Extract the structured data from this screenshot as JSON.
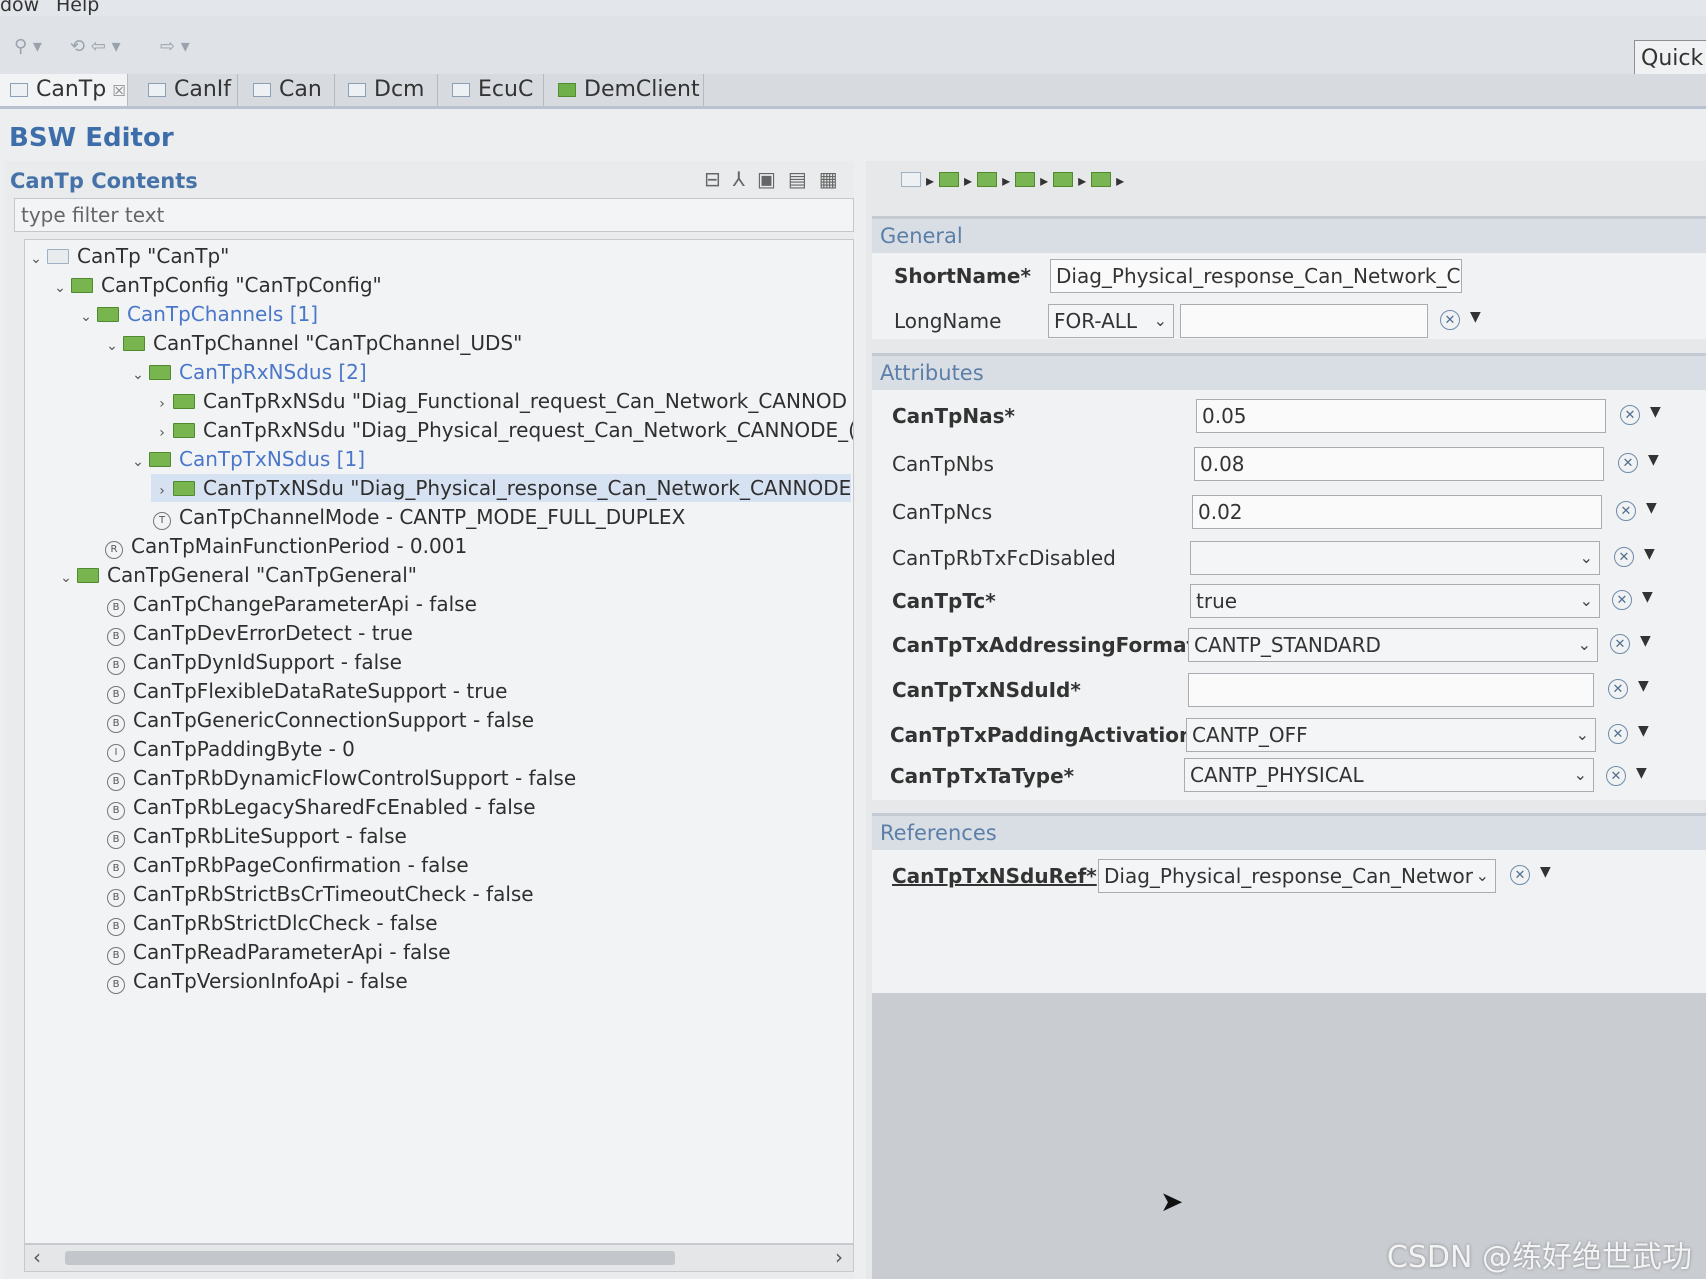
{
  "menu": {
    "window": "dow",
    "help": "Help"
  },
  "toolbar": {
    "quick_access": "Quick"
  },
  "tabs": [
    {
      "label": "CanTp",
      "close": "☒"
    },
    {
      "label": "CanIf"
    },
    {
      "label": "Can"
    },
    {
      "label": "Dcm"
    },
    {
      "label": "EcuC"
    },
    {
      "label": "DemClient"
    }
  ],
  "editor": {
    "title": "BSW Editor"
  },
  "left": {
    "title": "CanTp Contents",
    "filter_placeholder": "type filter text",
    "tree": [
      "CanTp \"CanTp\"",
      "CanTpConfig \"CanTpConfig\"",
      "CanTpChannels [1]",
      "CanTpChannel \"CanTpChannel_UDS\"",
      "CanTpRxNSdus [2]",
      "CanTpRxNSdu \"Diag_Functional_request_Can_Network_CANNOD",
      "CanTpRxNSdu \"Diag_Physical_request_Can_Network_CANNODE_(",
      "CanTpTxNSdus [1]",
      "CanTpTxNSdu \"Diag_Physical_response_Can_Network_CANNODE",
      "CanTpChannelMode - CANTP_MODE_FULL_DUPLEX",
      "CanTpMainFunctionPeriod - 0.001",
      "CanTpGeneral \"CanTpGeneral\"",
      "CanTpChangeParameterApi - false",
      "CanTpDevErrorDetect - true",
      "CanTpDynIdSupport - false",
      "CanTpFlexibleDataRateSupport - true",
      "CanTpGenericConnectionSupport - false",
      "CanTpPaddingByte - 0",
      "CanTpRbDynamicFlowControlSupport - false",
      "CanTpRbLegacySharedFcEnabled - false",
      "CanTpRbLiteSupport - false",
      "CanTpRbPageConfirmation - false",
      "CanTpRbStrictBsCrTimeoutCheck - false",
      "CanTpRbStrictDlcCheck - false",
      "CanTpReadParameterApi - false",
      "CanTpVersionInfoApi - false"
    ]
  },
  "general": {
    "header": "General",
    "shortname_label": "ShortName*",
    "shortname_value": "Diag_Physical_response_Can_Network_C",
    "longname_label": "LongName",
    "longname_lang": "FOR-ALL",
    "longname_value": ""
  },
  "attributes": {
    "header": "Attributes",
    "rows": [
      {
        "label": "CanTpNas*",
        "value": "0.05"
      },
      {
        "label": "CanTpNbs",
        "value": "0.08"
      },
      {
        "label": "CanTpNcs",
        "value": "0.02"
      },
      {
        "label": "CanTpRbTxFcDisabled",
        "value": ""
      },
      {
        "label": "CanTpTc*",
        "value": "true"
      },
      {
        "label": "CanTpTxAddressingFormat*",
        "value": "CANTP_STANDARD"
      },
      {
        "label": "CanTpTxNSduId*",
        "value": ""
      },
      {
        "label": "CanTpTxPaddingActivation*",
        "value": "CANTP_OFF"
      },
      {
        "label": "CanTpTxTaType*",
        "value": "CANTP_PHYSICAL"
      }
    ]
  },
  "references": {
    "header": "References",
    "ref_label": "CanTpTxNSduRef*",
    "ref_value": "Diag_Physical_response_Can_Networ"
  },
  "watermark": "CSDN @练好绝世武功"
}
